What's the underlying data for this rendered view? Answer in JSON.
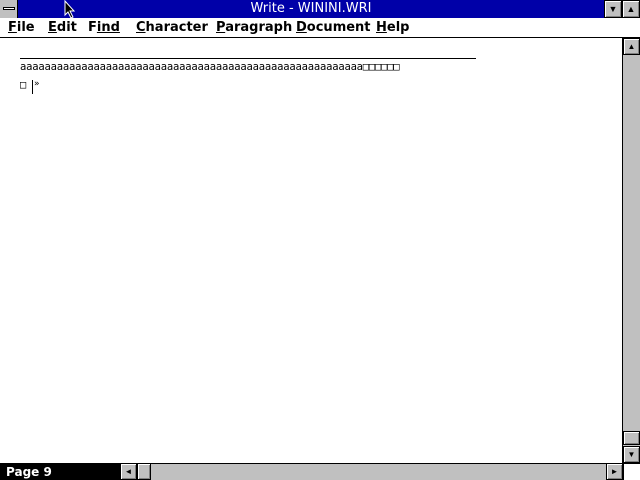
{
  "window": {
    "title": "Write - WININI.WRI",
    "minimize_glyph": "▼",
    "maximize_glyph": "▲",
    "sysmenu_icon": "system-menu-icon"
  },
  "menu": [
    {
      "first": "F",
      "rest": "ile"
    },
    {
      "first": "E",
      "rest": "dit"
    },
    {
      "first": "F",
      "rest": "ind",
      "pre": ""
    },
    {
      "first": "C",
      "rest": "haracter"
    },
    {
      "first": "P",
      "rest": "aragraph"
    },
    {
      "first": "D",
      "rest": "ocument"
    },
    {
      "first": "H",
      "rest": "elp"
    }
  ],
  "document": {
    "line1": "aaaaaaaaaaaaaaaaaaaaaaaaaaaaaaaaaaaaaaaaaaaaaaaaaaaaaaaa□□□□□□",
    "line2": "□",
    "page_break_mark": "»"
  },
  "scrollbars": {
    "up_glyph": "▲",
    "down_glyph": "▼",
    "left_glyph": "◄",
    "right_glyph": "►"
  },
  "status": {
    "page_label": "Page 9"
  },
  "colors": {
    "title_bar": "#0000a8",
    "chrome": "#c0c0c0"
  }
}
